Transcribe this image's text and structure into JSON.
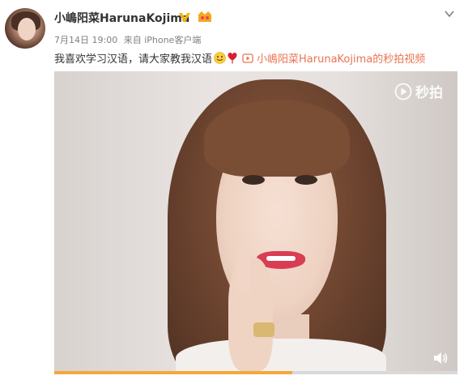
{
  "post": {
    "username": "小嶋阳菜HarunaKojima",
    "time": "7月14日 19:00",
    "source": "来自 iPhone客户端",
    "text": "我喜欢学习汉语，请大家教我汉语",
    "video_link_text": "小嶋阳菜HarunaKojima的秒拍视频",
    "accent_color": "#eb7350",
    "icons": [
      "verified-icon",
      "member-icon",
      "more-icon",
      "smile-icon",
      "heart-icon",
      "video-link-icon",
      "volume-icon"
    ]
  },
  "video": {
    "watermark": "秒拍",
    "progress_percent": 59
  }
}
